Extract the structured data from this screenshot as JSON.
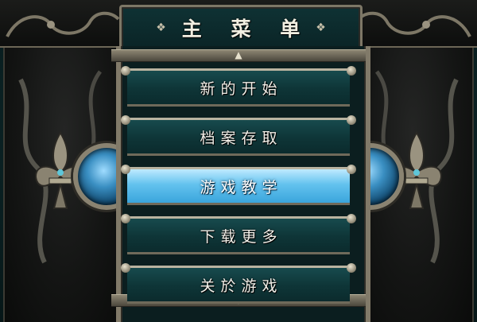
{
  "title": "主 菜 单",
  "title_decoration": "❖",
  "menu": {
    "items": [
      {
        "label": "新的开始",
        "selected": false
      },
      {
        "label": "档案存取",
        "selected": false
      },
      {
        "label": "游戏教学",
        "selected": true
      },
      {
        "label": "下载更多",
        "selected": false
      },
      {
        "label": "关於游戏",
        "selected": false
      }
    ]
  },
  "icons": {
    "scroll_up": "arrow-up-icon",
    "scroll_down": "arrow-down-icon",
    "ornament": "fleur-de-lis-icon",
    "orb": "blue-orb-icon"
  },
  "colors": {
    "background": "#0c2a2c",
    "selected_item": "#63c2ee",
    "frame": "#817a69",
    "text": "#f3f1ea"
  }
}
